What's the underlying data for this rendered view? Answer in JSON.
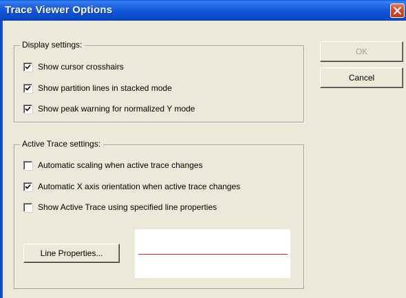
{
  "window": {
    "title": "Trace Viewer Options"
  },
  "buttons": {
    "ok": "OK",
    "cancel": "Cancel",
    "line_properties": "Line Properties..."
  },
  "display_settings": {
    "legend": "Display settings:",
    "items": [
      {
        "label": "Show cursor crosshairs",
        "checked": true
      },
      {
        "label": "Show partition lines in stacked mode",
        "checked": true
      },
      {
        "label": "Show peak warning for normalized Y mode",
        "checked": true
      }
    ]
  },
  "active_trace_settings": {
    "legend": "Active Trace settings:",
    "items": [
      {
        "label": "Automatic scaling when active trace changes",
        "checked": false
      },
      {
        "label": "Automatic X axis orientation when active trace changes",
        "checked": true
      },
      {
        "label": "Show Active Trace using specified line properties",
        "checked": false
      }
    ]
  },
  "colors": {
    "line_preview": "#e02020",
    "titlebar": "#0a4bc9",
    "dialog_bg": "#ece9d8"
  }
}
